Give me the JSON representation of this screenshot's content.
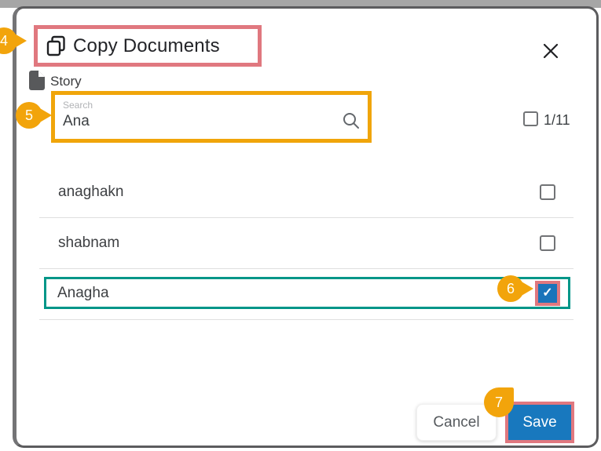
{
  "modal": {
    "title": "Copy Documents",
    "doc_type": "Story",
    "search": {
      "label": "Search",
      "value": "Ana"
    },
    "select_all": {
      "counter": "1/11",
      "checked": false
    },
    "items": [
      {
        "name": "anaghakn",
        "checked": false
      },
      {
        "name": "shabnam",
        "checked": false
      },
      {
        "name": "Anagha",
        "checked": true
      }
    ],
    "buttons": {
      "cancel": "Cancel",
      "save": "Save"
    }
  },
  "annotations": {
    "badges": [
      "4",
      "5",
      "6",
      "7"
    ],
    "colors": {
      "badge": "#F2A40B",
      "highlight_pink": "#E0787F",
      "highlight_orange": "#F0A50A",
      "highlight_teal": "#009688"
    }
  },
  "glyphs": {
    "checkmark": "✓"
  },
  "colors": {
    "save_button": "#1878BE",
    "checkbox_checked": "#1A74BA"
  }
}
